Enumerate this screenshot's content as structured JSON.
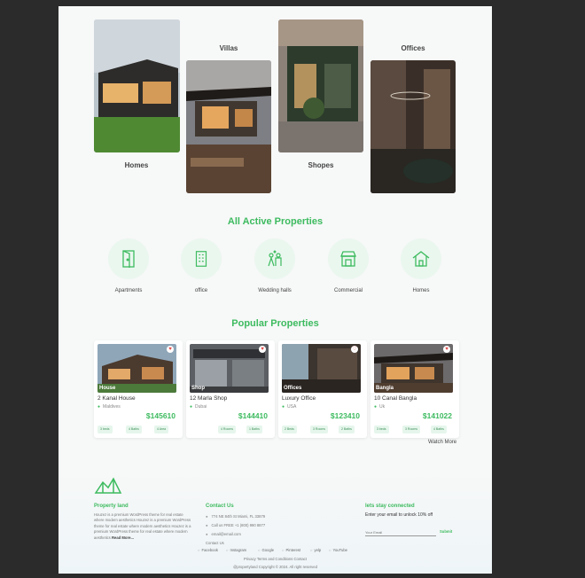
{
  "categories": [
    {
      "label": "Homes",
      "position": "below"
    },
    {
      "label": "Villas",
      "position": "above"
    },
    {
      "label": "Shopes",
      "position": "below"
    },
    {
      "label": "Offices",
      "position": "above"
    }
  ],
  "active_section": {
    "title": "All Active Properties",
    "types": [
      {
        "label": "Apartments",
        "icon": "door-icon"
      },
      {
        "label": "office",
        "icon": "building-icon"
      },
      {
        "label": "Wedding halls",
        "icon": "wedding-icon"
      },
      {
        "label": "Commercial",
        "icon": "shop-icon"
      },
      {
        "label": "Homes",
        "icon": "house-icon"
      }
    ]
  },
  "popular_section": {
    "title": "Popular Properties",
    "cards": [
      {
        "tag": "House",
        "title": "2 Kanal House",
        "location": "Maldives",
        "price": "$145610",
        "features": [
          "3 beds",
          "4 Baths",
          "4 Area"
        ]
      },
      {
        "tag": "Shop",
        "title": "12 Marla Shop",
        "location": "Dubai",
        "price": "$144410",
        "features": [
          "4 Rooms",
          "1 Baths"
        ]
      },
      {
        "tag": "Offices",
        "title": "Luxury Office",
        "location": "USA",
        "price": "$123410",
        "features": [
          "2 Beds",
          "3 Rooms",
          "2 Baths"
        ]
      },
      {
        "tag": "Bangla",
        "title": "10 Canal Bangla",
        "location": "Uk",
        "price": "$141022",
        "features": [
          "3 beds",
          "3 Rooms",
          "4 Baths"
        ]
      }
    ],
    "watch_more": "Watch More"
  },
  "footer": {
    "brand": "Property land",
    "about": "Houzez is a premium WordPress theme for real estate where modern aesthetics Houzez is a premium WordPress theme for real estate where modern aesthetics Houzez is a premium WordPress theme for real estate where modern aesthetics",
    "read_more": "Read More...",
    "contact_title": "Contact Us",
    "address": "774 NE 84th St Miami, FL 33879",
    "phone": "Call us FREE +1 (800) 990 8877",
    "email": "email@email.com",
    "contact_link": "Contact Us",
    "newsletter_title": "lets stay connected",
    "newsletter_text": "Enter your email to unlock 10% off",
    "email_placeholder": "Your Email",
    "submit": "Submit",
    "socials": [
      "Facebook",
      "Instagram",
      "Google",
      "Pinterest",
      "yelp",
      "YouTube"
    ],
    "privacy": "Privacy Terms and Conditions Contact",
    "copyright": "@propertyland Copyright © 2024. All right reserved"
  },
  "colors": {
    "accent": "#3dbb5f",
    "accent_light": "#eaf7ef"
  }
}
